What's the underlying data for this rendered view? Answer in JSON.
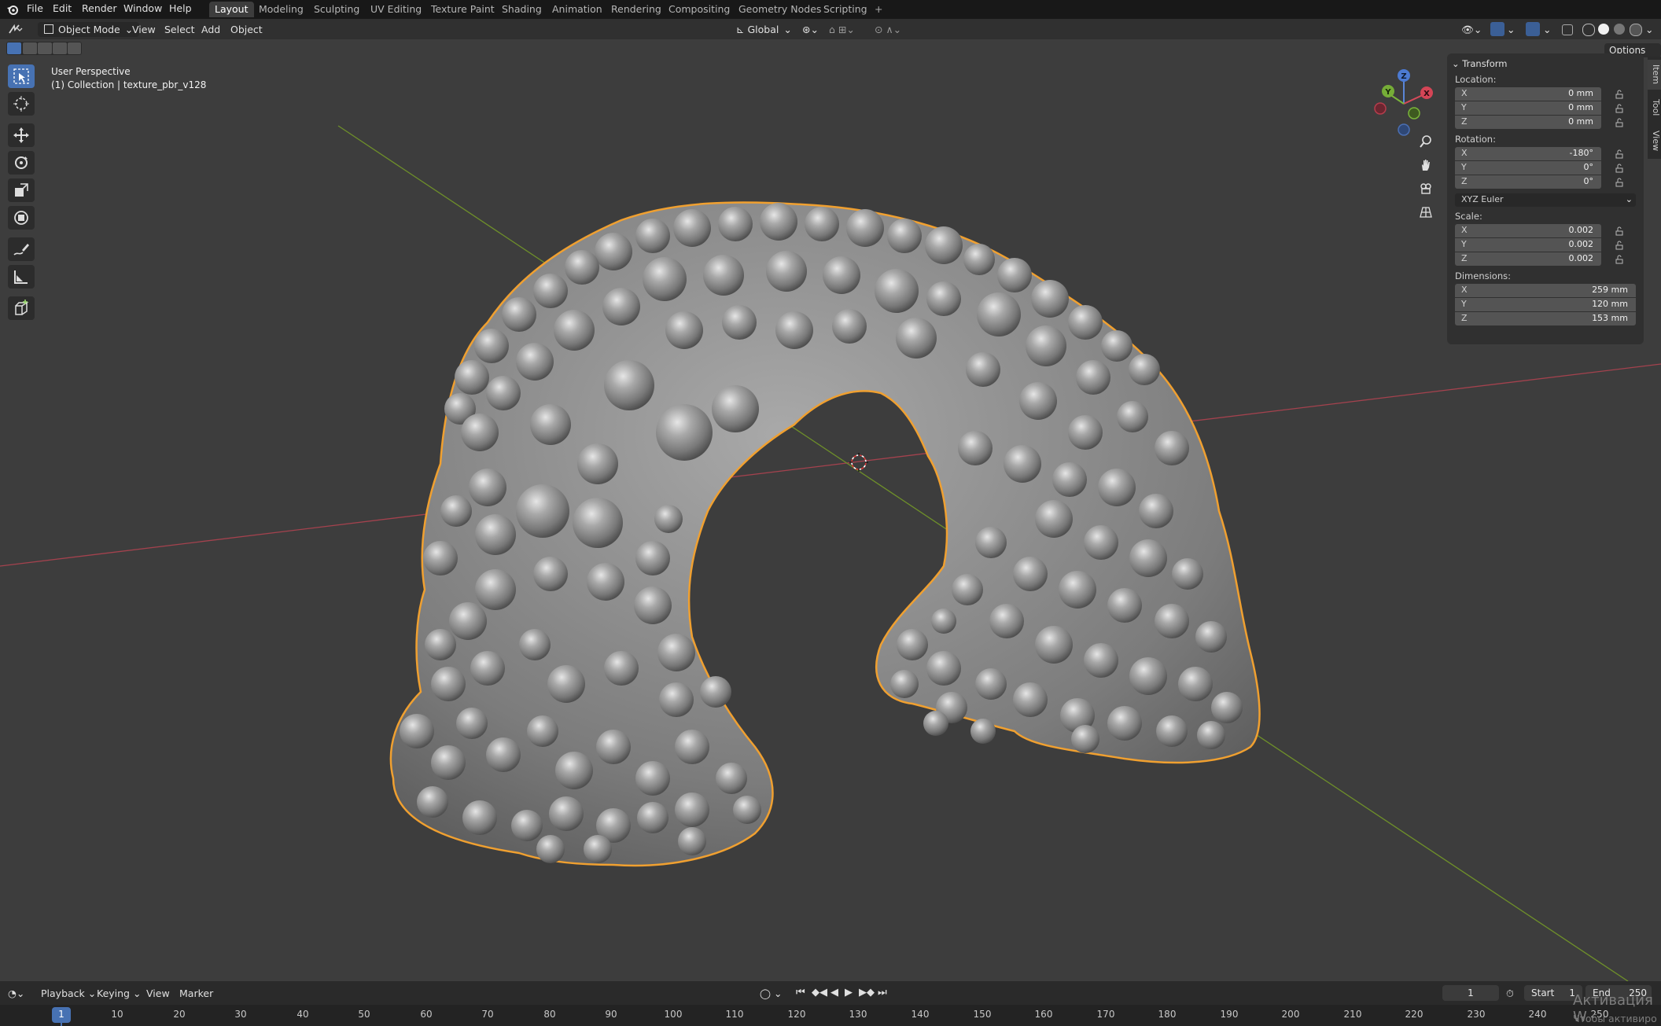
{
  "topbar": {
    "menus": [
      "File",
      "Edit",
      "Render",
      "Window",
      "Help"
    ],
    "workspaces": [
      "Layout",
      "Modeling",
      "Sculpting",
      "UV Editing",
      "Texture Paint",
      "Shading",
      "Animation",
      "Rendering",
      "Compositing",
      "Geometry Nodes",
      "Scripting"
    ],
    "active_workspace": "Layout",
    "add_tab": "+"
  },
  "header": {
    "mode": "Object Mode",
    "menus": [
      "View",
      "Select",
      "Add",
      "Object"
    ],
    "orientation": "Global",
    "options": "Options"
  },
  "viewport": {
    "perspective_label": "User Perspective",
    "collection_label": "(1) Collection | texture_pbr_v128",
    "background_color": "#3d3d3d",
    "selection_outline_color": "#f0a030",
    "x_axis_color": "#b33c4a",
    "y_axis_color": "#6e9a2a",
    "gizmo": {
      "x": "X",
      "y": "Y",
      "z": "Z"
    }
  },
  "tools": [
    "select-box-icon",
    "cursor-icon",
    "move-icon",
    "rotate-icon",
    "scale-icon",
    "transform-icon",
    "annotate-icon",
    "measure-icon",
    "add-cube-icon"
  ],
  "npanel": {
    "section": "Transform",
    "location_label": "Location:",
    "location": [
      {
        "axis": "X",
        "value": "0 mm"
      },
      {
        "axis": "Y",
        "value": "0 mm"
      },
      {
        "axis": "Z",
        "value": "0 mm"
      }
    ],
    "rotation_label": "Rotation:",
    "rotation": [
      {
        "axis": "X",
        "value": "-180°"
      },
      {
        "axis": "Y",
        "value": "0°"
      },
      {
        "axis": "Z",
        "value": "0°"
      }
    ],
    "rotation_mode": "XYZ Euler",
    "scale_label": "Scale:",
    "scale": [
      {
        "axis": "X",
        "value": "0.002"
      },
      {
        "axis": "Y",
        "value": "0.002"
      },
      {
        "axis": "Z",
        "value": "0.002"
      }
    ],
    "dimensions_label": "Dimensions:",
    "dimensions": [
      {
        "axis": "X",
        "value": "259 mm"
      },
      {
        "axis": "Y",
        "value": "120 mm"
      },
      {
        "axis": "Z",
        "value": "153 mm"
      }
    ],
    "tabs": [
      "Item",
      "Tool",
      "View"
    ]
  },
  "timeline": {
    "menus": [
      "Playback",
      "Keying",
      "View",
      "Marker"
    ],
    "current_frame": "1",
    "start_label": "Start",
    "start": "1",
    "end_label": "End",
    "end": "250",
    "ruler": [
      "1",
      "10",
      "20",
      "30",
      "40",
      "50",
      "60",
      "70",
      "80",
      "90",
      "100",
      "110",
      "120",
      "130",
      "140",
      "150",
      "160",
      "170",
      "180",
      "190",
      "200",
      "210",
      "220",
      "230",
      "240",
      "250"
    ],
    "watermark_1": "Активация W",
    "watermark_2": "Чтобы активиро"
  }
}
